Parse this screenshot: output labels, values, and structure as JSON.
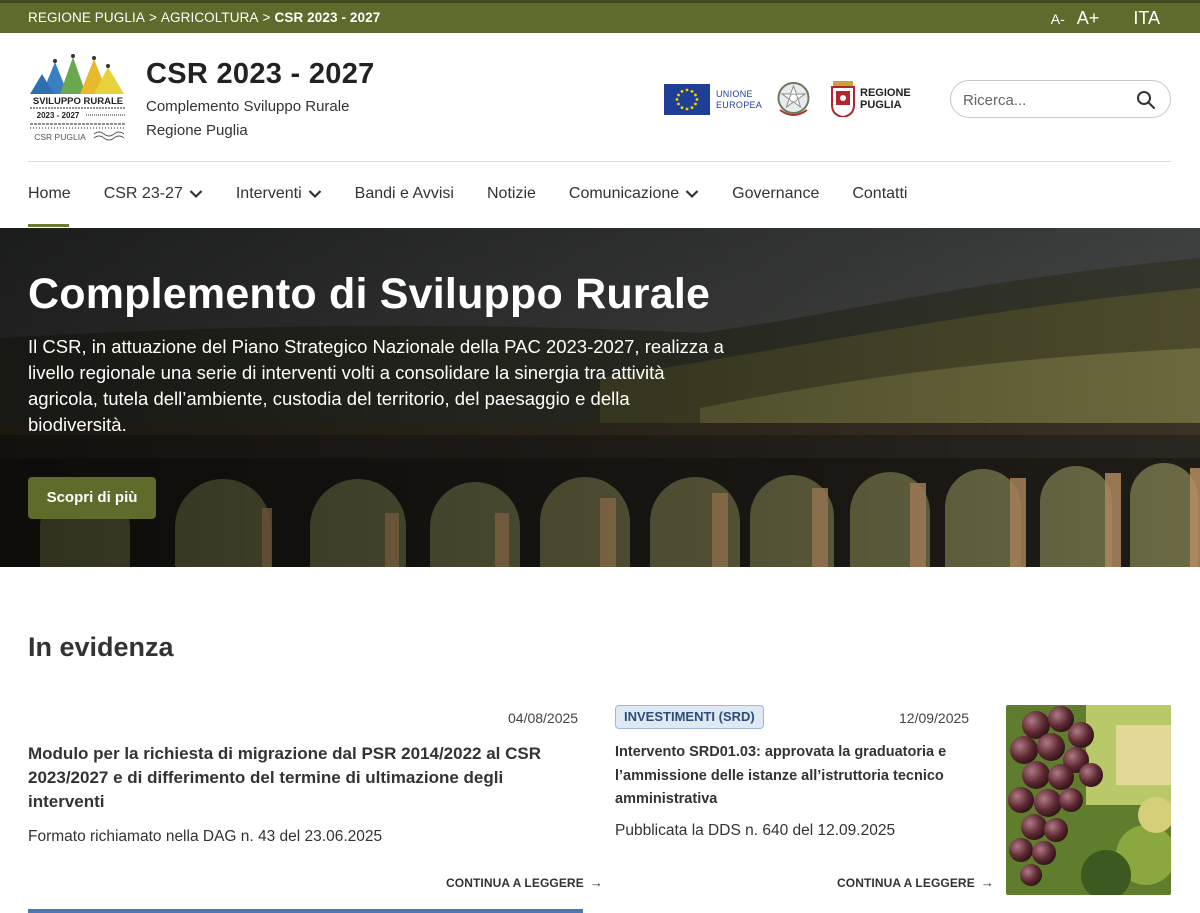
{
  "topbar": {
    "breadcrumb": [
      "REGIONE PUGLIA",
      "AGRICOLTURA",
      "CSR 2023 - 2027"
    ],
    "separator": ">",
    "font_decrease": "A-",
    "font_increase": "A+",
    "language": "ITA"
  },
  "header": {
    "logo_text": [
      "SVILUPPO RURALE",
      "2023 - 2027",
      "CSR PUGLIA"
    ],
    "title": "CSR 2023 - 2027",
    "subtitle_line1": "Complemento Sviluppo Rurale",
    "subtitle_line2": "Regione Puglia",
    "eu_label": [
      "UNIONE",
      "EUROPEA"
    ],
    "puglia_label": [
      "REGIONE",
      "PUGLIA"
    ],
    "search_placeholder": "Ricerca..."
  },
  "nav": {
    "items": [
      {
        "label": "Home",
        "dropdown": false,
        "active": true
      },
      {
        "label": "CSR 23-27",
        "dropdown": true
      },
      {
        "label": "Interventi",
        "dropdown": true
      },
      {
        "label": "Bandi e Avvisi",
        "dropdown": false
      },
      {
        "label": "Notizie",
        "dropdown": false
      },
      {
        "label": "Comunicazione",
        "dropdown": true
      },
      {
        "label": "Governance",
        "dropdown": false
      },
      {
        "label": "Contatti",
        "dropdown": false
      }
    ]
  },
  "hero": {
    "title": "Complemento di Sviluppo Rurale",
    "text": "Il CSR, in attuazione del Piano Strategico Nazionale della PAC 2023-2027, realizza a livello regionale una serie di interventi volti a consolidare la sinergia tra attività agricola, tutela dell’ambiente, custodia del territorio, del paesaggio e della biodiversità.",
    "button": "Scopri di più"
  },
  "section": {
    "title": "In evidenza",
    "cards": [
      {
        "date": "04/08/2025",
        "title": "Modulo per la richiesta di migrazione dal PSR 2014/2022 al CSR 2023/2027 e di differimento del termine di ultimazione degli interventi",
        "description": "Formato richiamato nella DAG n. 43 del 23.06.2025",
        "link": "CONTINUA A LEGGERE"
      },
      {
        "badge": "INVESTIMENTI (SRD)",
        "date": "12/09/2025",
        "title": "Intervento SRD01.03: approvata la graduatoria e l’ammissione delle istanze all’istruttoria tecnico amministrativa",
        "description": "Pubblicata la DDS n. 640 del 12.09.2025",
        "link": "CONTINUA A LEGGERE"
      }
    ]
  },
  "colors": {
    "brand_green": "#5d6b2c",
    "button_green": "#5e6b2a",
    "card_accent_blue": "#4a78b5"
  }
}
